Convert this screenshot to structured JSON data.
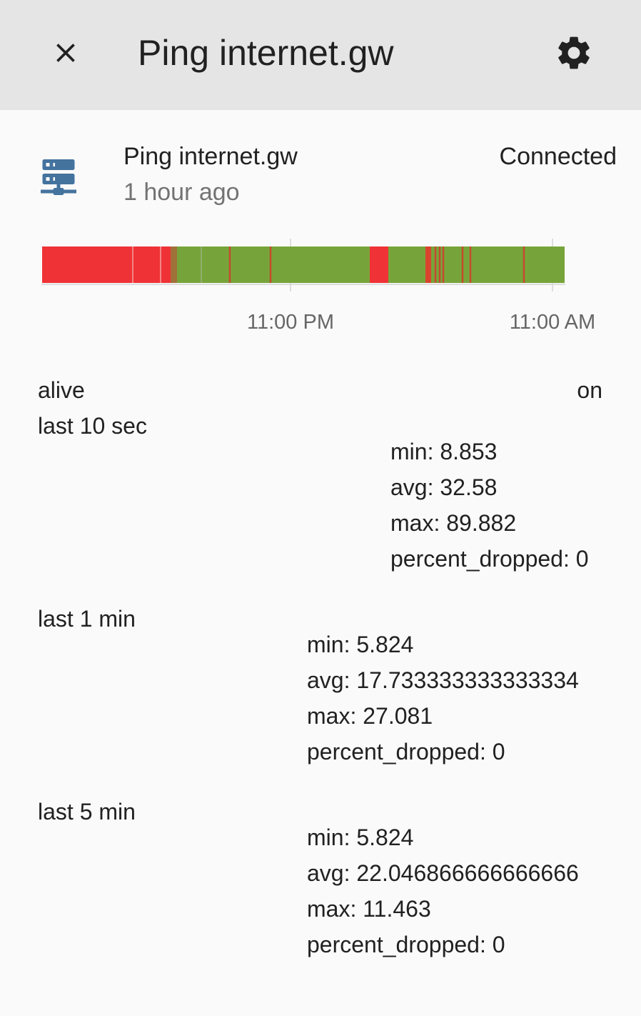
{
  "toolbar": {
    "title": "Ping internet.gw",
    "close_icon": "close-icon",
    "settings_icon": "gear-icon"
  },
  "entity": {
    "icon": "server-network-icon",
    "name": "Ping internet.gw",
    "last_changed": "1 hour ago",
    "state": "Connected"
  },
  "timeline": {
    "tick_labels": [
      "11:00 PM",
      "11:00 AM"
    ],
    "colors": {
      "off": "#ef3236",
      "on": "#77a43a"
    }
  },
  "attributes": {
    "alive": {
      "label": "alive",
      "value": "on"
    },
    "last_10_sec": {
      "label": "last 10 sec",
      "min": "min: 8.853",
      "avg": "avg: 32.58",
      "max": "max: 89.882",
      "percent_dropped": "percent_dropped: 0"
    },
    "last_1_min": {
      "label": "last 1 min",
      "min": "min: 5.824",
      "avg": "avg: 17.733333333333334",
      "max": "max: 27.081",
      "percent_dropped": "percent_dropped: 0"
    },
    "last_5_min": {
      "label": "last 5 min",
      "min": "min: 5.824",
      "avg": "avg: 22.046866666666666",
      "max": "max: 11.463",
      "percent_dropped": "percent_dropped: 0"
    }
  }
}
